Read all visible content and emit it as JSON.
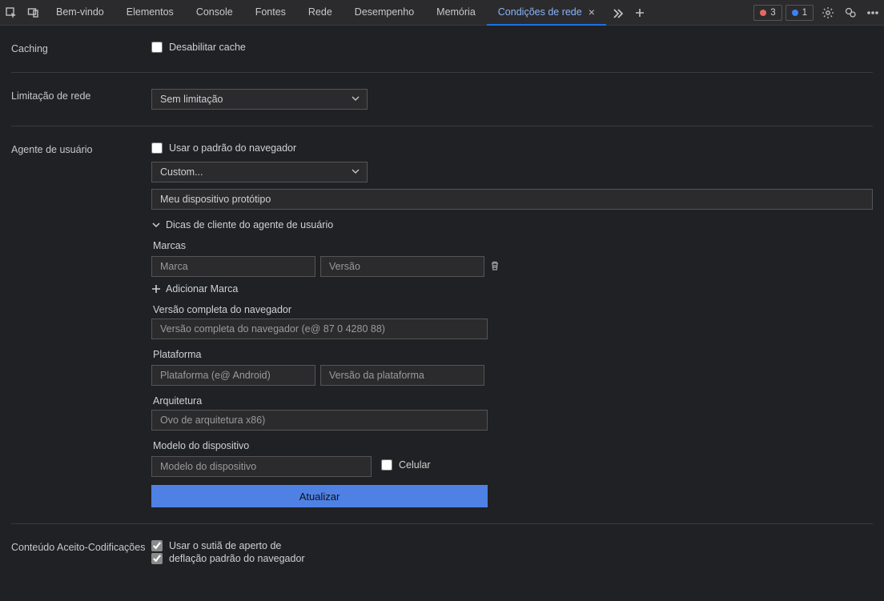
{
  "tabs": {
    "welcome": "Bem-vindo",
    "elements": "Elementos",
    "console": "Console",
    "sources": "Fontes",
    "network": "Rede",
    "performance": "Desempenho",
    "memory": "Memória",
    "network_conditions": "Condições de rede"
  },
  "badges": {
    "errors": "3",
    "info": "1"
  },
  "caching": {
    "section": "Caching",
    "disable_cache": "Desabilitar cache"
  },
  "throttling": {
    "section": "Limitação de rede",
    "selected": "Sem limitação"
  },
  "user_agent": {
    "section": "Agente de usuário",
    "use_browser_default": "Usar o padrão do navegador",
    "preset_selected": "Custom...",
    "custom_value": "Meu dispositivo protótipo",
    "hints_header": "Dicas de cliente do agente de usuário",
    "brands_label": "Marcas",
    "brand_placeholder": "Marca",
    "version_placeholder": "Versão",
    "add_brand": "Adicionar Marca",
    "full_version_label": "Versão completa do navegador",
    "full_version_placeholder": "Versão completa do navegador (e@ 87 0 4280 88)",
    "platform_label": "Plataforma",
    "platform_placeholder": "Plataforma (e@ Android)",
    "platform_version_placeholder": "Versão da plataforma",
    "architecture_label": "Arquitetura",
    "architecture_placeholder": "Ovo de arquitetura x86)",
    "device_model_label": "Modelo do dispositivo",
    "device_model_placeholder": "Modelo do dispositivo",
    "mobile_label": "Celular",
    "update_button": "Atualizar"
  },
  "encodings": {
    "section": "Conteúdo Aceito-Codificações",
    "line1": "Usar o sutiã de aperto de",
    "line2": "deflação padrão do navegador"
  }
}
